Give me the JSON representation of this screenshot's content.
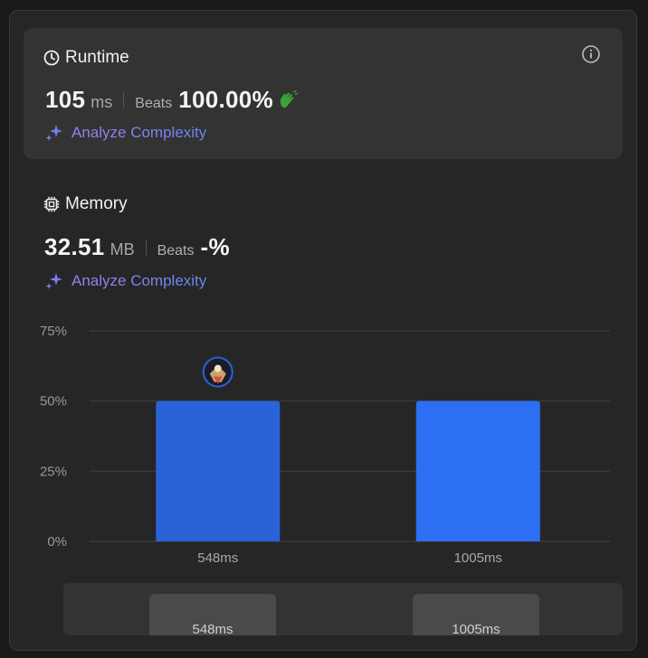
{
  "runtime": {
    "title": "Runtime",
    "value": "105",
    "unit": "ms",
    "beats_label": "Beats",
    "beats_value": "100.00%",
    "analyze_label": "Analyze Complexity"
  },
  "memory": {
    "title": "Memory",
    "value": "32.51",
    "unit": "MB",
    "beats_label": "Beats",
    "beats_value": "-%",
    "analyze_label": "Analyze Complexity"
  },
  "colors": {
    "bar_selected": "#2a62d8",
    "bar": "#2d6ff2",
    "accent_purple": "#8d7cf0",
    "wave_green": "#3aa33a"
  },
  "icons": {
    "runtime": "clock-icon",
    "memory": "chip-icon",
    "info": "info-icon",
    "analyze": "sparkle-icon",
    "beats_badge": "waving-hand-icon",
    "bar_marker": "user-avatar"
  },
  "chart_data": {
    "type": "bar",
    "categories": [
      "548ms",
      "1005ms"
    ],
    "values": [
      50,
      50
    ],
    "ylim": [
      0,
      75
    ],
    "yticks": [
      "0%",
      "25%",
      "50%",
      "75%"
    ],
    "ytick_values": [
      0,
      25,
      50,
      75
    ],
    "grid": true,
    "selected_index": 0
  },
  "range_strip": {
    "labels": [
      "548ms",
      "1005ms"
    ]
  }
}
